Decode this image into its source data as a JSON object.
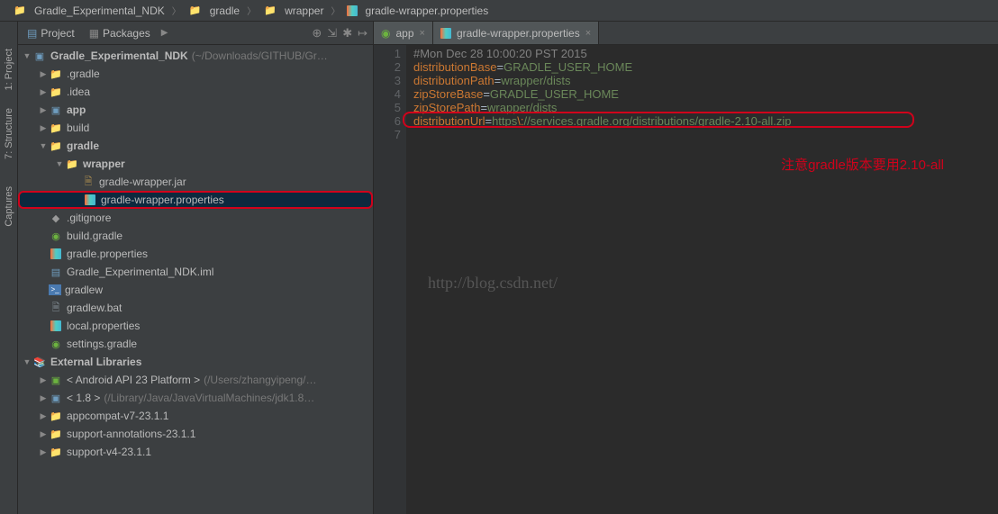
{
  "breadcrumb": [
    {
      "icon": "project",
      "label": "Gradle_Experimental_NDK"
    },
    {
      "icon": "folder",
      "label": "gradle"
    },
    {
      "icon": "folder",
      "label": "wrapper"
    },
    {
      "icon": "prop",
      "label": "gradle-wrapper.properties"
    }
  ],
  "panel": {
    "project_tab": "Project",
    "packages_tab": "Packages"
  },
  "rail": {
    "project": "1: Project",
    "structure": "7: Structure",
    "captures": "Captures"
  },
  "tree": [
    {
      "d": 0,
      "disc": "▼",
      "icon": "project",
      "bold": true,
      "label": "Gradle_Experimental_NDK",
      "hint": " (~/Downloads/GITHUB/Gr…"
    },
    {
      "d": 1,
      "disc": "▶",
      "icon": "folder-closed",
      "label": ".gradle"
    },
    {
      "d": 1,
      "disc": "▶",
      "icon": "folder-closed",
      "label": ".idea"
    },
    {
      "d": 1,
      "disc": "▶",
      "icon": "module",
      "bold": true,
      "label": "app"
    },
    {
      "d": 1,
      "disc": "▶",
      "icon": "folder",
      "label": "build"
    },
    {
      "d": 1,
      "disc": "▼",
      "icon": "folder",
      "bold": true,
      "label": "gradle"
    },
    {
      "d": 2,
      "disc": "▼",
      "icon": "folder",
      "bold": true,
      "label": "wrapper"
    },
    {
      "d": 3,
      "disc": "",
      "icon": "jar",
      "label": "gradle-wrapper.jar"
    },
    {
      "d": 3,
      "disc": "",
      "icon": "prop",
      "label": "gradle-wrapper.properties",
      "selected": true,
      "highlight": true
    },
    {
      "d": 1,
      "disc": "",
      "icon": "git",
      "label": ".gitignore"
    },
    {
      "d": 1,
      "disc": "",
      "icon": "gradle",
      "label": "build.gradle"
    },
    {
      "d": 1,
      "disc": "",
      "icon": "prop",
      "label": "gradle.properties"
    },
    {
      "d": 1,
      "disc": "",
      "icon": "iml",
      "label": "Gradle_Experimental_NDK.iml"
    },
    {
      "d": 1,
      "disc": "",
      "icon": "sh",
      "label": "gradlew"
    },
    {
      "d": 1,
      "disc": "",
      "icon": "file",
      "label": "gradlew.bat"
    },
    {
      "d": 1,
      "disc": "",
      "icon": "prop",
      "label": "local.properties"
    },
    {
      "d": 1,
      "disc": "",
      "icon": "gradle",
      "label": "settings.gradle"
    },
    {
      "d": 0,
      "disc": "▼",
      "icon": "lib",
      "bold": true,
      "label": "External Libraries"
    },
    {
      "d": 1,
      "disc": "▶",
      "icon": "lib-android",
      "label": "< Android API 23 Platform >",
      "hint": " (/Users/zhangyipeng/…"
    },
    {
      "d": 1,
      "disc": "▶",
      "icon": "lib-java",
      "label": "< 1.8 >",
      "hint": " (/Library/Java/JavaVirtualMachines/jdk1.8…"
    },
    {
      "d": 1,
      "disc": "▶",
      "icon": "lib-folder",
      "label": "appcompat-v7-23.1.1"
    },
    {
      "d": 1,
      "disc": "▶",
      "icon": "lib-folder",
      "label": "support-annotations-23.1.1"
    },
    {
      "d": 1,
      "disc": "▶",
      "icon": "lib-folder",
      "label": "support-v4-23.1.1"
    }
  ],
  "editor_tabs": [
    {
      "icon": "gradle",
      "label": "app",
      "active": false
    },
    {
      "icon": "prop",
      "label": "gradle-wrapper.properties",
      "active": true
    }
  ],
  "code": {
    "lines": [
      1,
      2,
      3,
      4,
      5,
      6,
      7
    ],
    "l1": "#Mon Dec 28 10:00:20 PST 2015",
    "l2k": "distributionBase",
    "l2v": "GRADLE_USER_HOME",
    "l3k": "distributionPath",
    "l3v": "wrapper/dists",
    "l4k": "zipStoreBase",
    "l4v": "GRADLE_USER_HOME",
    "l5k": "zipStorePath",
    "l5v": "wrapper/dists",
    "l6k": "distributionUrl",
    "l6v1": "https",
    "l6esc": "\\:",
    "l6v2": "//services.gradle.org/distributions/gradle-2.10-all.zip"
  },
  "annotation": "注意gradle版本要用2.10-all",
  "watermark": "http://blog.csdn.net/"
}
